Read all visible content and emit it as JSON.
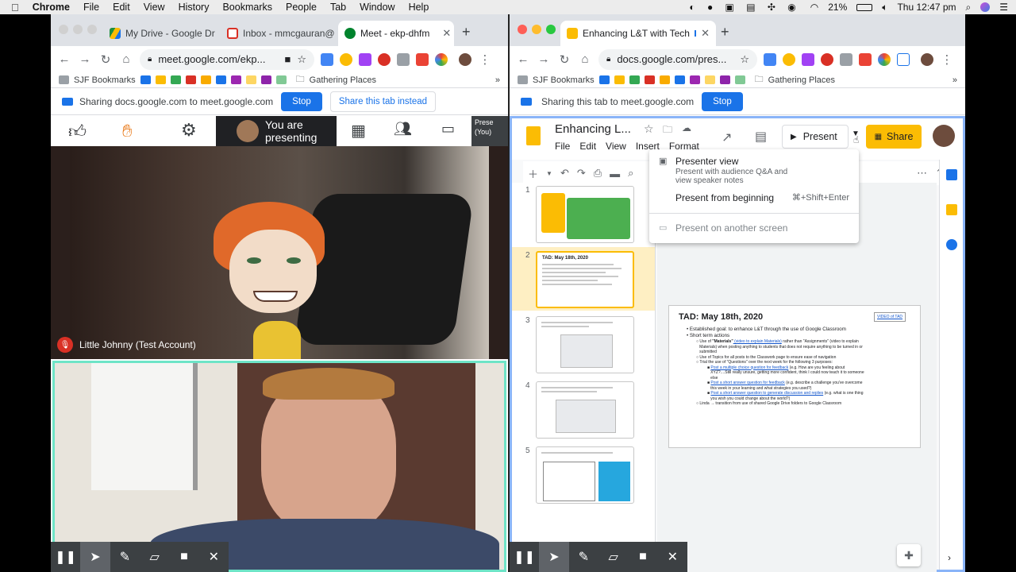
{
  "menubar": {
    "app": "Chrome",
    "items": [
      "File",
      "Edit",
      "View",
      "History",
      "Bookmarks",
      "People",
      "Tab",
      "Window",
      "Help"
    ],
    "battery": "21%",
    "clock": "Thu 12:47 pm"
  },
  "left": {
    "tabs": [
      {
        "label": "My Drive - Google Dr",
        "fav": "#1e8e3e"
      },
      {
        "label": "Inbox - mmcgauran@",
        "fav": "#d93025"
      },
      {
        "label": "Meet - ekp-dhfm",
        "fav": "#00832d"
      }
    ],
    "url": "meet.google.com/ekp...",
    "bookmarks": {
      "first": "SJF Bookmarks",
      "folder": "Gathering Places"
    },
    "share": {
      "text": "Sharing docs.google.com to meet.google.com",
      "stop": "Stop",
      "alt": "Share this tab instead"
    },
    "meet": {
      "presenting": "You are presenting",
      "presenter_tile": "Prese (You)",
      "participant": "Little Johnny (Test Account)"
    },
    "colors": {
      "tile_border": "#6ee4c7",
      "highlight_bar": "#ffffff"
    }
  },
  "right": {
    "tab": "Enhancing L&T with Tech",
    "url": "docs.google.com/pres...",
    "bookmarks": {
      "first": "SJF Bookmarks",
      "folder": "Gathering Places"
    },
    "share": {
      "text": "Sharing this tab to meet.google.com",
      "stop": "Stop"
    },
    "doc_title": "Enhancing L...",
    "menu": [
      "File",
      "Edit",
      "View",
      "Insert",
      "Format"
    ],
    "present_label": "Present",
    "share_label": "Share",
    "dropdown": {
      "presenter_view": "Presenter view",
      "presenter_desc1": "Present with audience Q&A and",
      "presenter_desc2": "view speaker notes",
      "from_beginning": "Present from beginning",
      "shortcut": "⌘+Shift+Enter",
      "other_screen": "Present on another screen"
    },
    "slide_numbers": [
      "1",
      "2",
      "3",
      "4",
      "5"
    ],
    "slide": {
      "title": "TAD: May 18th, 2020",
      "video_link": "VIDEO of TAD",
      "b1": "Established goal: to enhance L&T through the use of Google Classroom",
      "b2": "Short term actions",
      "s1a": "Use of ",
      "s1b": "\"Materials\"",
      "s1c": " (video to explain Materials)",
      "s1d": " rather than \"Assignments\" (video to explain",
      "s1e": "Materials) when posting anything to students that does not require anything to be turned in or",
      "s1f": "submitted",
      "s2": "Use of Topics for all posts to the Classwork page to ensure ease of navigation",
      "s3": "Trial the use of \"Questions\" over the next week for the following 3 purposes:",
      "q1a": "Post a multiple choice question for feedback",
      "q1b": " (e.g. How are you feeling about",
      "q1c": "XYZ?....Still really unsure, getting more confident, think I could now teach it to someone",
      "q1d": "else",
      "q2a": "Post a short answer question for feedback",
      "q2b": " (e.g. describe a challenge you've overcome",
      "q2c": "this week in your learning and what strategies you used?)",
      "q3a": "Post a short answer question to generate discussion and replies",
      "q3b": " (e.g. what is one thing",
      "q3c": "you wish you could change about the world?)",
      "b3": "Linda → transition from use of shared Google Drive folders to Google Classroom"
    },
    "thumb2_title": "TAD: May 18th, 2020",
    "accent": "#fbbc04"
  }
}
